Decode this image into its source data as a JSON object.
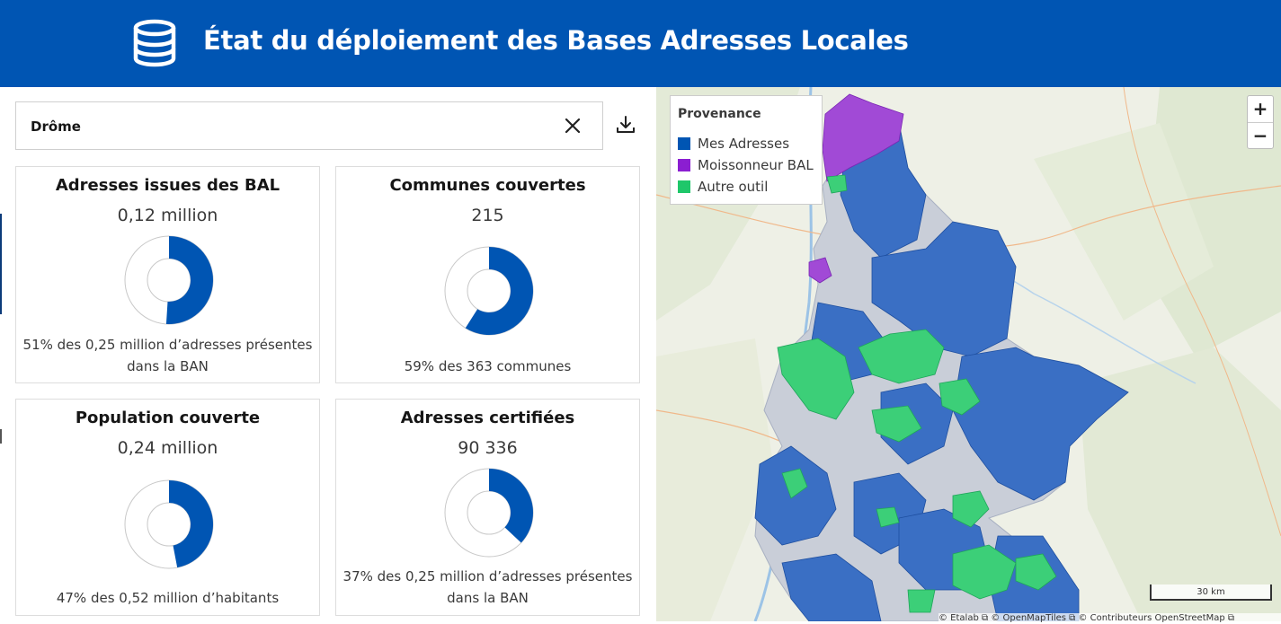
{
  "header": {
    "title": "État du déploiement des Bases Adresses Locales",
    "icon": "database-icon"
  },
  "search": {
    "value": "Drôme",
    "clear_icon": "close-icon"
  },
  "download_icon": "download-icon",
  "cards": [
    {
      "title": "Adresses issues des BAL",
      "value": "0,12 million",
      "percent": 51,
      "desc": "51% des 0,25 million d’adresses présentes dans la BAN"
    },
    {
      "title": "Communes couvertes",
      "value": "215",
      "percent": 59,
      "desc": "59% des 363 communes"
    },
    {
      "title": "Population couverte",
      "value": "0,24 million",
      "percent": 47,
      "desc": "47% des 0,52 million d’habitants"
    },
    {
      "title": "Adresses certifiées",
      "value": "90 336",
      "percent": 37,
      "desc": "37% des 0,25 million d’adresses présentes dans la BAN"
    }
  ],
  "colors": {
    "primary": "#0055b3",
    "mes_adresses": "#0055b3",
    "moissonneur": "#8b1ed1",
    "autre_outil": "#1fc76a",
    "uncovered": "#c7ccd6"
  },
  "legend": {
    "title": "Provenance",
    "items": [
      {
        "label": "Mes Adresses",
        "color": "#0055b3"
      },
      {
        "label": "Moissonneur BAL",
        "color": "#8b1ed1"
      },
      {
        "label": "Autre outil",
        "color": "#1fc76a"
      }
    ]
  },
  "map": {
    "zoom_in": "+",
    "zoom_out": "−",
    "scale_label": "30 km",
    "attribution": "© Etalab ⧉ © OpenMapTiles ⧉ © Contributeurs OpenStreetMap ⧉"
  }
}
